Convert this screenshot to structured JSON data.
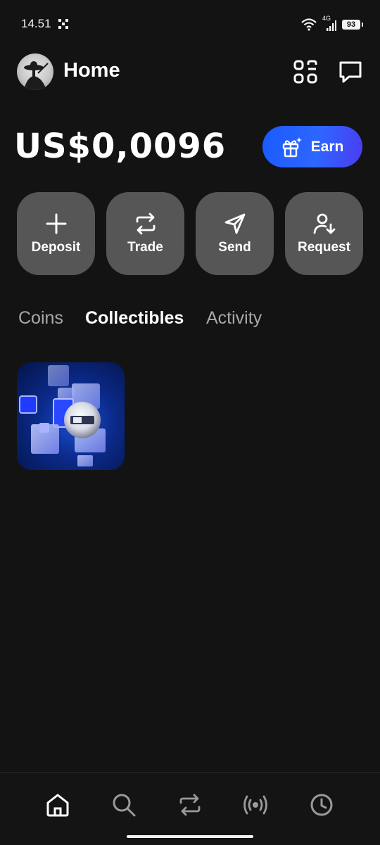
{
  "status_bar": {
    "time": "14.51",
    "network": "4G",
    "battery": "93"
  },
  "header": {
    "title": "Home",
    "avatar_icon": "profile-avatar",
    "scan_icon": "qr-scan-icon",
    "chat_icon": "message-icon"
  },
  "balance": {
    "amount": "US$0,0096"
  },
  "earn": {
    "label": "Earn",
    "icon": "gift-icon",
    "gradient_start": "#1a5bff",
    "gradient_end": "#4b3cf0"
  },
  "actions": [
    {
      "label": "Deposit",
      "icon": "plus-icon"
    },
    {
      "label": "Trade",
      "icon": "swap-icon"
    },
    {
      "label": "Send",
      "icon": "send-icon"
    },
    {
      "label": "Request",
      "icon": "request-user-icon"
    }
  ],
  "tabs": [
    {
      "label": "Coins",
      "active": false
    },
    {
      "label": "Collectibles",
      "active": true
    },
    {
      "label": "Activity",
      "active": false
    }
  ],
  "collectibles": [
    {
      "icon": "collectible-nft-image"
    }
  ],
  "bottom_nav": [
    {
      "icon": "home-icon",
      "active": true
    },
    {
      "icon": "search-icon",
      "active": false
    },
    {
      "icon": "swap-icon",
      "active": false
    },
    {
      "icon": "broadcast-icon",
      "active": false
    },
    {
      "icon": "clock-icon",
      "active": false
    }
  ],
  "colors": {
    "background": "#131313",
    "button_bg": "#565656",
    "tab_inactive": "#a8a8a8",
    "accent": "#1a5bff"
  }
}
